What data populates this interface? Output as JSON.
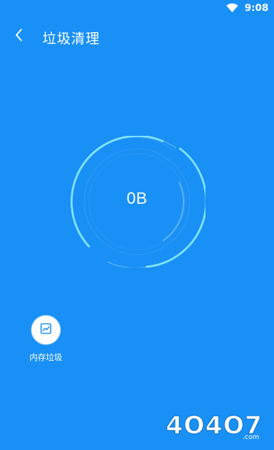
{
  "status": {
    "time": "9:08",
    "icons": [
      "wifi-icon"
    ]
  },
  "header": {
    "back_icon": "chevron-left-icon",
    "title": "垃圾清理"
  },
  "gauge": {
    "value": "0B"
  },
  "actions": [
    {
      "icon": "chart-icon",
      "label": "内存垃圾"
    }
  ],
  "watermark": {
    "text": "4O4O7.com"
  },
  "colors": {
    "background": "#1990F5",
    "ring": "#7FE3F9",
    "ring_inner": "#5FB1F8"
  }
}
